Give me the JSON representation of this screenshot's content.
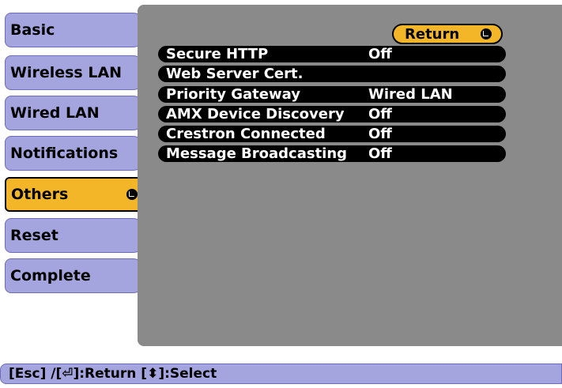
{
  "nav": {
    "items": [
      {
        "label": "Basic"
      },
      {
        "label": "Wireless LAN"
      },
      {
        "label": "Wired LAN"
      },
      {
        "label": "Notifications"
      },
      {
        "label": "Others",
        "selected": true
      },
      {
        "label": "Reset"
      },
      {
        "label": "Complete"
      }
    ]
  },
  "panel": {
    "return_label": "Return",
    "rows": [
      {
        "label": "Secure HTTP",
        "value": "Off"
      },
      {
        "label": "Web Server Cert.",
        "value": ""
      },
      {
        "label": "Priority Gateway",
        "value": "Wired LAN"
      },
      {
        "label": "AMX Device Discovery",
        "value": "Off"
      },
      {
        "label": "Crestron Connected",
        "value": "Off"
      },
      {
        "label": "Message Broadcasting",
        "value": "Off"
      }
    ]
  },
  "status_bar": {
    "text": "[Esc] /[⏎]:Return  [⬍]:Select"
  },
  "colors": {
    "nav_bg": "#a4a4de",
    "selected_bg": "#f2b628",
    "panel_bg": "#8a8a8a",
    "row_bg": "#000000",
    "row_text": "#ffffff"
  },
  "icons": {
    "enter": "enter-icon",
    "updown": "updown-arrow-icon"
  }
}
